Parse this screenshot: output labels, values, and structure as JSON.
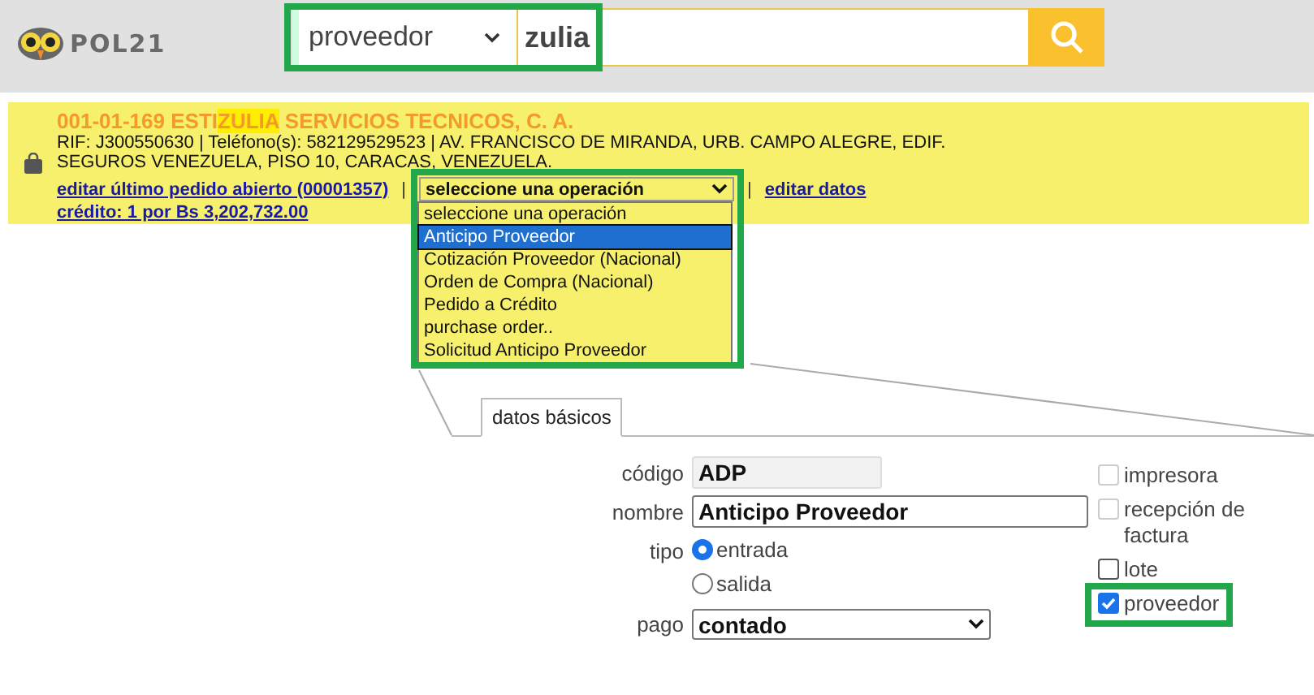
{
  "header": {
    "logo": "POL21",
    "search": {
      "category": "proveedor",
      "query": "zulia",
      "highlighted": true
    }
  },
  "result": {
    "title": {
      "before": "001-01-169 ESTI",
      "match": "ZULIA",
      "after": " SERVICIOS TECNICOS, C. A."
    },
    "details": "RIF: J300550630 | Teléfono(s): 582129529523 | AV. FRANCISCO DE MIRANDA, URB. CAMPO ALEGRE, EDIF. SEGUROS VENEZUELA, PISO 10, CARACAS, VENEZUELA.",
    "links": [
      {
        "kind": "link",
        "label": "editar último pedido abierto (00001357)"
      },
      {
        "kind": "separator",
        "label": "|"
      },
      {
        "kind": "select",
        "label": "seleccione una operación"
      },
      {
        "kind": "separator",
        "label": "|"
      },
      {
        "kind": "link",
        "label": "editar datos"
      }
    ],
    "credit": "crédito: 1 por Bs 3,202,732.00",
    "operation_menu": {
      "expanded": true,
      "highlighted": true,
      "options": [
        {
          "label": "seleccione una operación",
          "selected": false
        },
        {
          "label": "Anticipo Proveedor",
          "selected": true
        },
        {
          "label": "Cotización Proveedor (Nacional)",
          "selected": false
        },
        {
          "label": "Orden de Compra (Nacional)",
          "selected": false
        },
        {
          "label": "Pedido a Crédito",
          "selected": false
        },
        {
          "label": "purchase order..",
          "selected": false
        },
        {
          "label": "Solicitud Anticipo Proveedor",
          "selected": false
        }
      ]
    }
  },
  "tabs": [
    {
      "label": "datos básicos",
      "selected": true
    }
  ],
  "form": {
    "codigo": {
      "label": "código",
      "value": "ADP",
      "disabled": true
    },
    "nombre": {
      "label": "nombre",
      "value": "Anticipo Proveedor"
    },
    "tipo": {
      "label": "tipo",
      "options": [
        {
          "label": "entrada",
          "selected": true
        },
        {
          "label": "salida",
          "selected": false
        }
      ]
    },
    "pago": {
      "label": "pago",
      "value": "contado"
    },
    "flags": [
      {
        "label": "impresora",
        "checked": false,
        "disabled": true,
        "highlighted": false
      },
      {
        "label": "recepción de factura",
        "checked": false,
        "disabled": true,
        "highlighted": false
      },
      {
        "label": "lote",
        "checked": false,
        "disabled": false,
        "highlighted": false
      },
      {
        "label": "proveedor",
        "checked": true,
        "disabled": false,
        "highlighted": true
      }
    ]
  }
}
